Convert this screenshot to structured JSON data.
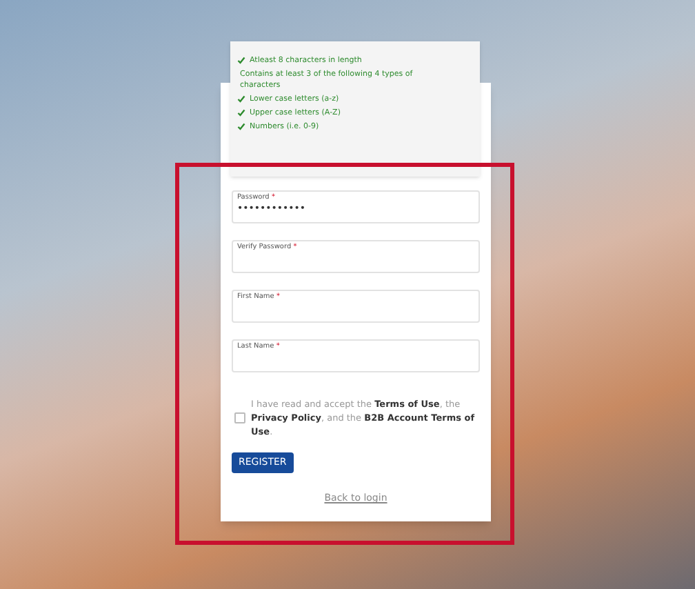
{
  "password_rules": [
    {
      "text": "Atleast 8 characters in length",
      "met": true
    },
    {
      "text": "Contains at least 3 of the following 4 types of characters",
      "kind": "heading"
    },
    {
      "text": "Lower case letters (a-z)",
      "met": true
    },
    {
      "text": "Upper case letters (A-Z)",
      "met": true
    },
    {
      "text": "Numbers (i.e. 0-9)",
      "met": true
    }
  ],
  "fields": [
    {
      "label": "Password",
      "required_mark": "*",
      "value": "••••••••••••"
    },
    {
      "label": "Verify Password",
      "required_mark": "*"
    },
    {
      "label": "First Name",
      "required_mark": "*"
    },
    {
      "label": "Last Name",
      "required_mark": "*"
    }
  ],
  "terms": {
    "text": "I have read and accept the **Terms of Use**, the **Privacy Policy**, and the **B2B Account Terms of Use**.",
    "checked": false
  },
  "register_button": "REGISTER",
  "back_link": "Back to login",
  "highlight": true
}
